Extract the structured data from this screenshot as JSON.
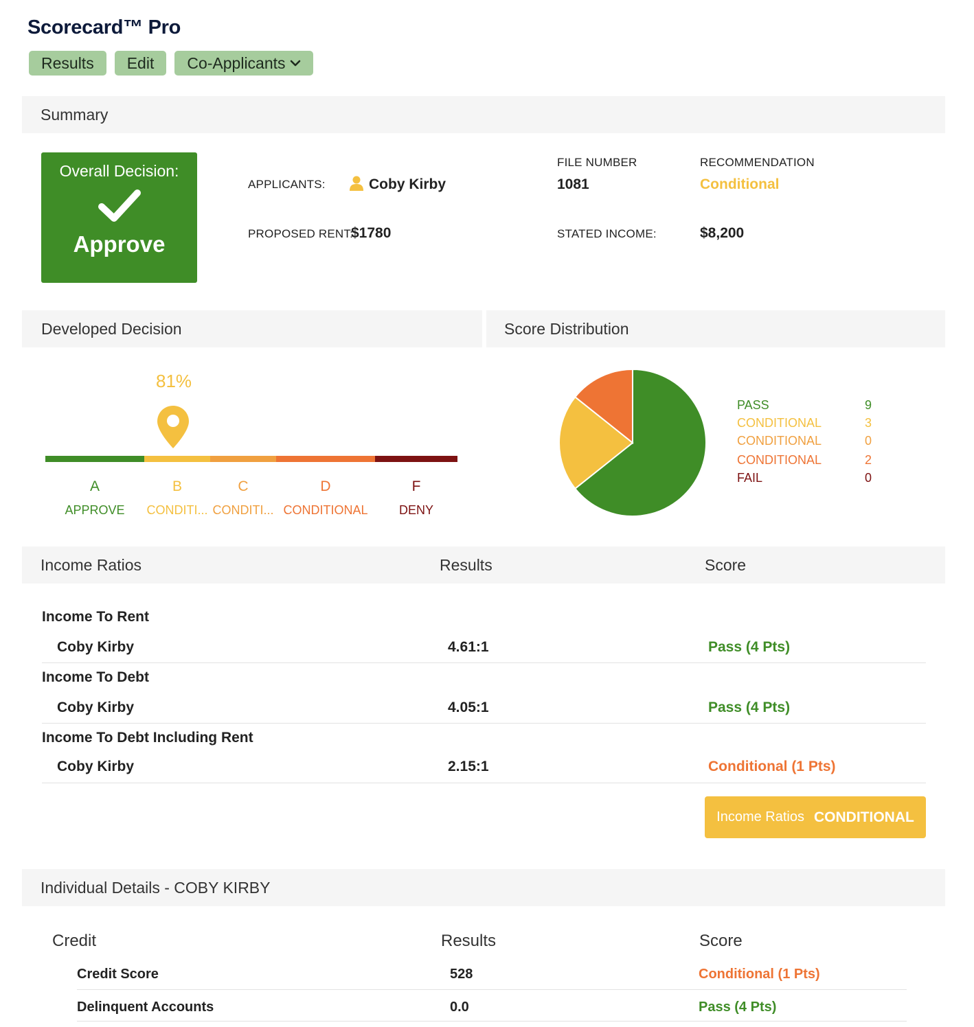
{
  "app": {
    "title": "Scorecard™ Pro"
  },
  "nav": {
    "results": "Results",
    "edit": "Edit",
    "co_applicants": "Co-Applicants"
  },
  "summary": {
    "section_title": "Summary",
    "overall_decision_label": "Overall Decision:",
    "overall_decision_value": "Approve",
    "applicants_label": "APPLICANTS:",
    "applicant_name": "Coby Kirby",
    "file_number_label": "FILE NUMBER",
    "file_number": "1081",
    "recommendation_label": "RECOMMENDATION",
    "recommendation": "Conditional",
    "proposed_rent_label": "PROPOSED RENT:",
    "proposed_rent": "$1780",
    "stated_income_label": "STATED INCOME:",
    "stated_income": "$8,200"
  },
  "developed_decision": {
    "section_title": "Developed Decision",
    "percent_label": "81%",
    "position_fraction": 0.31,
    "grades": [
      {
        "letter": "A",
        "name": "APPROVE",
        "color": "#3f8d27"
      },
      {
        "letter": "B",
        "name": "CONDITI...",
        "color": "#f4c040"
      },
      {
        "letter": "C",
        "name": "CONDITI...",
        "color": "#f0a040"
      },
      {
        "letter": "D",
        "name": "CONDITIONAL",
        "color": "#ee7434"
      },
      {
        "letter": "F",
        "name": "DENY",
        "color": "#7d1212"
      }
    ]
  },
  "score_distribution": {
    "section_title": "Score Distribution",
    "legend": [
      {
        "name": "PASS",
        "count": "9",
        "color": "#3f8d27"
      },
      {
        "name": "CONDITIONAL",
        "count": "3",
        "color": "#f4c040"
      },
      {
        "name": "CONDITIONAL",
        "count": "0",
        "color": "#f0a040"
      },
      {
        "name": "CONDITIONAL",
        "count": "2",
        "color": "#ee7434"
      },
      {
        "name": "FAIL",
        "count": "0",
        "color": "#7d1212"
      }
    ]
  },
  "income_ratios": {
    "header": {
      "title": "Income Ratios",
      "results": "Results",
      "score": "Score"
    },
    "groups": [
      {
        "title": "Income To Rent",
        "name": "Coby Kirby",
        "result": "4.61:1",
        "score": "Pass (4 Pts)",
        "score_color": "#3f8d27"
      },
      {
        "title": "Income To Debt",
        "name": "Coby Kirby",
        "result": "4.05:1",
        "score": "Pass (4 Pts)",
        "score_color": "#3f8d27"
      },
      {
        "title": "Income To Debt Including Rent",
        "name": "Coby Kirby",
        "result": "2.15:1",
        "score": "Conditional (1 Pts)",
        "score_color": "#ee7434"
      }
    ],
    "summary_label": "Income Ratios",
    "summary_value": "CONDITIONAL"
  },
  "individual_details": {
    "section_title": "Individual Details - COBY KIRBY",
    "credit_header": {
      "title": "Credit",
      "results": "Results",
      "score": "Score"
    },
    "rows": [
      {
        "name": "Credit Score",
        "result": "528",
        "score": "Conditional (1 Pts)",
        "score_color": "#ee7434"
      },
      {
        "name": "Delinquent Accounts",
        "result": "0.0",
        "score": "Pass (4 Pts)",
        "score_color": "#3f8d27"
      }
    ]
  }
}
